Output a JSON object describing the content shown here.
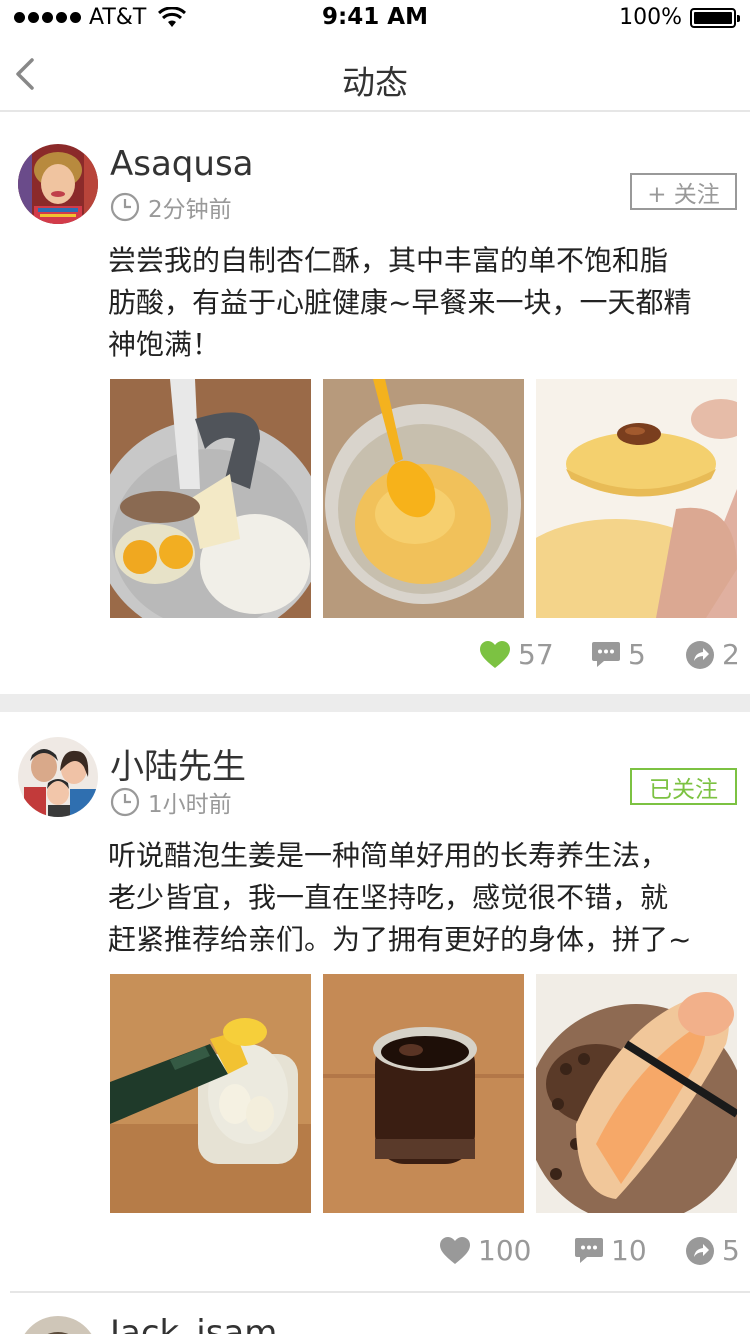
{
  "status_bar": {
    "carrier": "AT&T",
    "time": "9:41 AM",
    "battery": "100%"
  },
  "nav": {
    "title": "动态"
  },
  "posts": [
    {
      "username": "Asaqusa",
      "time": "2分钟前",
      "follow_label": "+ 关注",
      "text_lines": [
        "尝尝我的自制杏仁酥，其中丰富的单不饱和脂",
        "肪酸，有益于心脏健康~早餐来一块，一天都精",
        "神饱满！"
      ],
      "likes": "57",
      "comments": "5",
      "shares": "2",
      "liked": true
    },
    {
      "username": "小陆先生",
      "time": "1小时前",
      "follow_label": "已关注",
      "text_lines": [
        "听说醋泡生姜是一种简单好用的长寿养生法，",
        "老少皆宜，我一直在坚持吃，感觉很不错，就",
        "赶紧推荐给亲们。为了拥有更好的身体，拼了~"
      ],
      "likes": "100",
      "comments": "10",
      "shares": "5",
      "liked": false
    },
    {
      "username": "Jack_isam"
    }
  ],
  "colors": {
    "accent_green": "#7cc242",
    "gray_text": "#999999",
    "divider": "#ececec"
  }
}
